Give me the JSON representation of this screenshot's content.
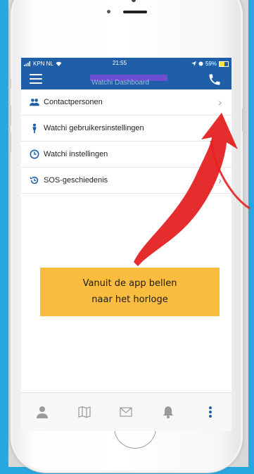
{
  "status": {
    "carrier": "KPN NL",
    "time": "21:55",
    "battery": "59%"
  },
  "appbar": {
    "title": "Watchi Dashboard",
    "menu_icon": "hamburger-icon",
    "call_icon": "phone-icon"
  },
  "menu": {
    "items": [
      {
        "label": "Contactpersonen",
        "icon": "contacts-icon"
      },
      {
        "label": "Watchi gebruikersinstellingen",
        "icon": "person-icon"
      },
      {
        "label": "Watchi instellingen",
        "icon": "clock-icon"
      },
      {
        "label": "SOS-geschiedenis",
        "icon": "history-icon"
      }
    ]
  },
  "tabbar": {
    "tabs": [
      "profile-icon",
      "map-icon",
      "mail-icon",
      "bell-icon",
      "more-icon"
    ]
  },
  "callout": {
    "line1": "Vanuit de app bellen",
    "line2": "naar het horloge"
  },
  "colors": {
    "appbar": "#1e5fa8",
    "frame": "#28a8e0",
    "callout": "#fbbd3f",
    "arrow": "#e52222"
  }
}
